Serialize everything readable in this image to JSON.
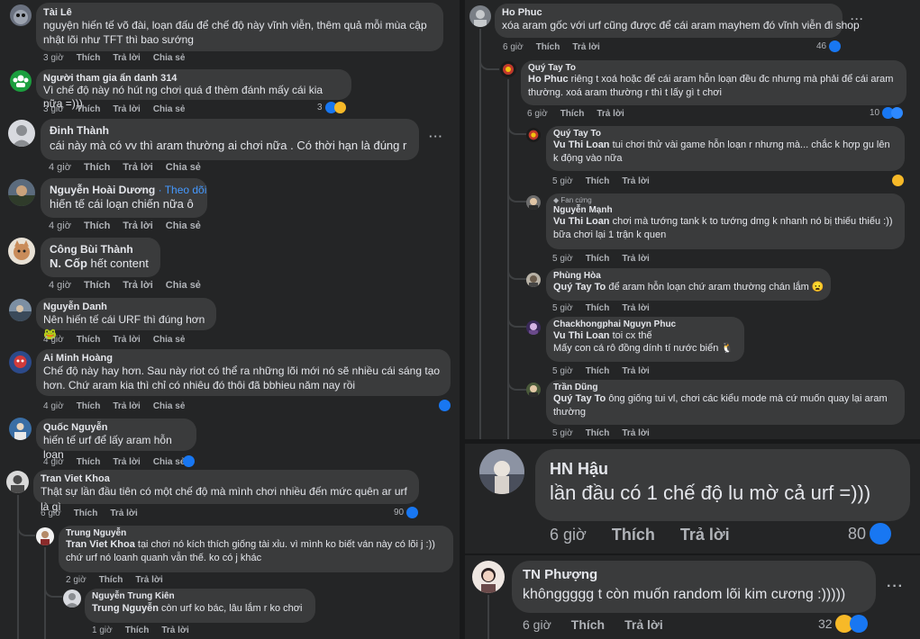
{
  "actions": {
    "like": "Thích",
    "reply": "Trả lời",
    "share": "Chia sẻ",
    "more": "···"
  },
  "colors": {
    "background": "#18191a",
    "bubble": "#3a3b3c",
    "link": "#4599ff",
    "like": "#1877f2"
  },
  "left": [
    {
      "name": "Tài Lê",
      "text": "nguyện hiến tế võ đài, loạn đấu để chế độ này vĩnh viễn, thêm quả mỗi mùa cập nhật lõi như TFT thì bao sướng",
      "time": "3 giờ"
    },
    {
      "name": "Người tham gia ẩn danh 314",
      "text": "Vì chế độ này nó hút ng chơi quá đ thèm đánh mấy cái kia nữa =)))",
      "time": "3 giờ",
      "reactions": "3"
    },
    {
      "name": "Đinh Thành",
      "text": "cái này mà có vv thì aram thường ai chơi nữa . Có thời hạn là đúng r",
      "time": "4 giờ"
    },
    {
      "name": "Nguyễn Hoài Dương",
      "follow": "· Theo dõi",
      "text": "hiến tế cái loạn chiến nữa ô",
      "time": "4 giờ"
    },
    {
      "name": "Công Bùi Thành",
      "mention": "N. Cốp",
      "text": " hết content",
      "time": "4 giờ"
    },
    {
      "name": "Nguyễn Danh",
      "text": "Nên hiến tế cái URF thì đúng hơn 🐸",
      "time": "4 giờ"
    },
    {
      "name": "Ai Minh Hoàng",
      "text": "Chế độ này hay hơn. Sau này riot có thể ra những lõi mới nó sẽ nhiều cái sáng tạo hơn. Chứ aram kia thì chỉ có nhiêu đó thôi đã bbhieu năm nay rồi",
      "time": "4 giờ"
    },
    {
      "name": "Quốc Nguyễn",
      "text": "hiến tế urf để lấy aram hỗn loạn",
      "time": "4 giờ"
    },
    {
      "name": "Tran Viet Khoa",
      "text": "Thật sự lần đầu tiên có một chế độ mà mình chơi nhiều đến mức quên ar urf là gì",
      "time": "6 giờ",
      "reactions": "90"
    },
    {
      "name": "Trung Nguyễn",
      "mention": "Tran Viet Khoa",
      "text": " tại chơi nó kích thích giống tài xỉu. vì mình ko biết ván này có lõi j :)) chứ urf nó loanh quanh vẫn thế. ko có j khác",
      "time": "2 giờ"
    },
    {
      "name": "Nguyễn Trung Kiên",
      "mention": "Trung Nguyễn",
      "text": " còn urf ko bác, lâu lắm r ko chơi",
      "time": "1 giờ"
    }
  ],
  "right": [
    {
      "name": "Ho Phuc",
      "text": "xóa aram gốc với urf cũng được để cái aram mayhem đó vĩnh viễn đi shop",
      "time": "6 giờ",
      "reactions": "46"
    },
    {
      "name": "Quý Tay To",
      "mention": "Ho Phuc",
      "text": " riêng t xoá hoặc để cái aram hỗn loạn đều đc nhưng mà phải để cái aram thường. xoá aram thường r thì t lấy gì t chơi",
      "time": "6 giờ",
      "reactions": "10"
    },
    {
      "name": "Quý Tay To",
      "mention": "Vu Thi Loan",
      "text": " tui chơi thử vài game hỗn loạn r nhưng mà... chắc k hợp gu lên k động vào nữa",
      "time": "5 giờ"
    },
    {
      "badge": "Fan cứng",
      "name": "Nguyễn Mạnh",
      "mention": "Vu Thi Loan",
      "text": " chơi mà tướng tank k to tướng dmg k nhanh nó bị thiếu thiếu :)) bữa chơi lại 1 trận k quen",
      "time": "5 giờ"
    },
    {
      "name": "Phùng Hòa",
      "mention": "Quý Tay To",
      "text": " để aram hỗn loạn chứ aram thường chán lắm 😦",
      "time": "5 giờ"
    },
    {
      "name": "Chackhongphai Nguyn Phuc",
      "mention": "Vu Thi Loan",
      "text": " toi cx thế",
      "text2": "Mấy con cá rô đồng dính tí nước biển 🐧",
      "time": "5 giờ"
    },
    {
      "name": "Trần Dũng",
      "mention": "Quý Tay To",
      "text": " ông giống tui vl, chơi các kiểu mode mà cứ muốn quay lại aram thường",
      "time": "5 giờ"
    }
  ],
  "large": [
    {
      "name": "HN Hậu",
      "text": "lần đầu có 1 chế độ lu mờ cả urf =)))",
      "time": "6 giờ",
      "reactions": "80"
    },
    {
      "name": "TN Phượng",
      "text": "khônggggg t còn muốn random lõi kim cương :)))))",
      "time": "6 giờ",
      "reactions": "32"
    }
  ]
}
